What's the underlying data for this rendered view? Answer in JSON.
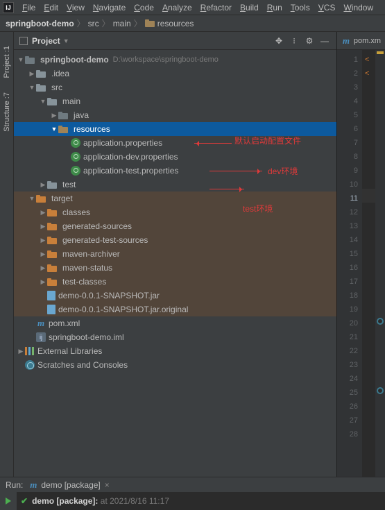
{
  "menu": {
    "items": [
      "File",
      "Edit",
      "View",
      "Navigate",
      "Code",
      "Analyze",
      "Refactor",
      "Build",
      "Run",
      "Tools",
      "VCS",
      "Window"
    ]
  },
  "breadcrumbs": {
    "project": "springboot-demo",
    "segments": [
      "src",
      "main"
    ],
    "current": "resources"
  },
  "sidebar": {
    "tabs": [
      {
        "num": "1",
        "label": "Project"
      },
      {
        "num": "7",
        "label": "Structure"
      }
    ]
  },
  "project_panel": {
    "title": "Project",
    "root": {
      "name": "springboot-demo",
      "path": "D:\\workspace\\springboot-demo"
    },
    "idea": ".idea",
    "src": "src",
    "main": "main",
    "java": "java",
    "resources": "resources",
    "files": {
      "app_prop": "application.properties",
      "app_dev": "application-dev.properties",
      "app_test": "application-test.properties"
    },
    "test": "test",
    "target": "target",
    "target_children": [
      "classes",
      "generated-sources",
      "generated-test-sources",
      "maven-archiver",
      "maven-status",
      "test-classes"
    ],
    "jars": {
      "jar": "demo-0.0.1-SNAPSHOT.jar",
      "orig": "demo-0.0.1-SNAPSHOT.jar.original"
    },
    "pom": "pom.xml",
    "iml": "springboot-demo.iml",
    "ext_lib": "External Libraries",
    "scratches": "Scratches and Consoles"
  },
  "annotations": {
    "default_cfg": "默认启动配置文件",
    "dev": "dev环境",
    "test": "test环境"
  },
  "editor": {
    "tab": "pom.xm",
    "lines": 28,
    "current_line": 11,
    "markers": [
      {
        "line": 20,
        "type": "dot"
      },
      {
        "line": 25,
        "type": "dot"
      }
    ],
    "warn_line": 1
  },
  "run": {
    "title": "Run:",
    "tab": "demo [package]",
    "status_label": "demo [package]:",
    "status_time": "at 2021/8/16 11:17"
  }
}
